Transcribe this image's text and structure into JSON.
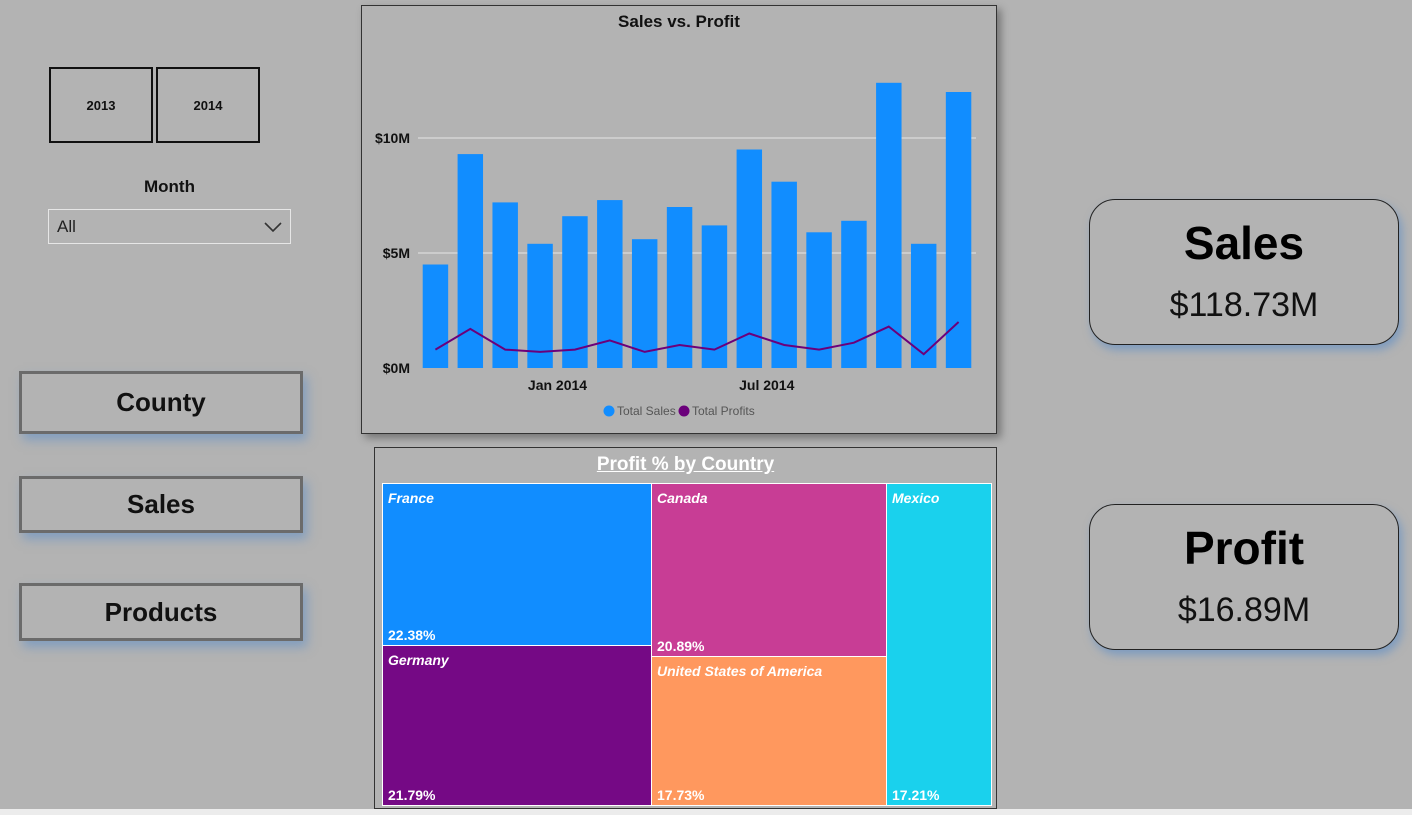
{
  "slicers": {
    "years": [
      "2013",
      "2014"
    ],
    "month_label": "Month",
    "month_value": "All"
  },
  "nav": {
    "county": "County",
    "sales": "Sales",
    "products": "Products"
  },
  "chart_data": {
    "type": "bar",
    "title": "Sales vs. Profit",
    "y_ticks": [
      "$0M",
      "$5M",
      "$10M"
    ],
    "ylim": [
      0,
      14
    ],
    "x_ticks": [
      "Jan 2014",
      "Jul 2014"
    ],
    "x": [
      "2013-09",
      "2013-10",
      "2013-11",
      "2013-12",
      "2014-01",
      "2014-02",
      "2014-03",
      "2014-04",
      "2014-05",
      "2014-06",
      "2014-07",
      "2014-08",
      "2014-09",
      "2014-10",
      "2014-11",
      "2014-12"
    ],
    "series": [
      {
        "name": "Total Sales",
        "type": "bar",
        "color": "#118dff",
        "values": [
          4.5,
          9.3,
          7.2,
          5.4,
          6.6,
          7.3,
          5.6,
          7.0,
          6.2,
          9.5,
          8.1,
          5.9,
          6.4,
          12.4,
          5.4,
          12.0
        ]
      },
      {
        "name": "Total Profits",
        "type": "line",
        "color": "#6b007b",
        "values": [
          0.8,
          1.7,
          0.8,
          0.7,
          0.8,
          1.2,
          0.7,
          1.0,
          0.8,
          1.5,
          1.0,
          0.8,
          1.1,
          1.8,
          0.6,
          2.0
        ]
      }
    ],
    "legend_position": "bottom-center",
    "grid": true
  },
  "treemap": {
    "title": "Profit % by Country",
    "tiles": [
      {
        "name": "France",
        "value": "22.38%",
        "color": "#118dff"
      },
      {
        "name": "Germany",
        "value": "21.79%",
        "color": "#750985"
      },
      {
        "name": "Canada",
        "value": "20.89%",
        "color": "#c83d95"
      },
      {
        "name": "United States of America",
        "value": "17.73%",
        "color": "#ff985e"
      },
      {
        "name": "Mexico",
        "value": "17.21%",
        "color": "#1ad1ed"
      }
    ]
  },
  "kpis": {
    "sales": {
      "title": "Sales",
      "value": "$118.73M"
    },
    "profit": {
      "title": "Profit",
      "value": "$16.89M"
    }
  }
}
